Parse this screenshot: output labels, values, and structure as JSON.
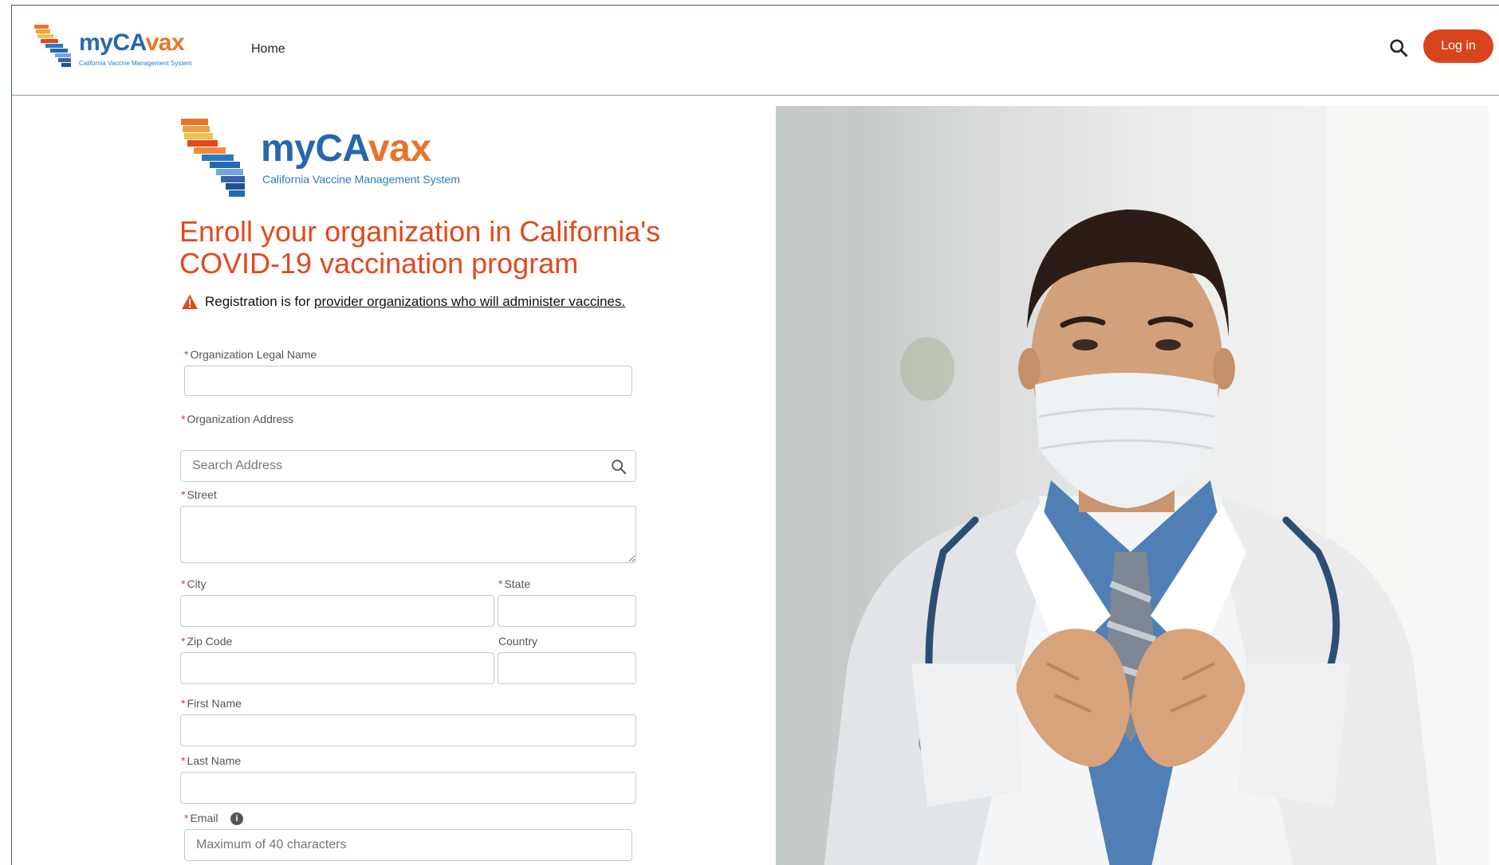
{
  "header": {
    "logo_word_part1": "myCA",
    "logo_word_part2": "vax",
    "logo_tagline": "California Vaccine Management System",
    "nav_home": "Home",
    "login_label": "Log in"
  },
  "brand": {
    "primary_orange": "#d9441c",
    "logo_blue": "#2567b0",
    "logo_orange": "#e8742a"
  },
  "main_logo": {
    "word_part1": "myCA",
    "word_part2": "vax",
    "tagline": "California Vaccine Management System"
  },
  "form": {
    "title_line1": "Enroll your organization in California's",
    "title_line2": "COVID-19 vaccination program",
    "notice_prefix": "Registration is for ",
    "notice_link": "provider organizations who will administer vaccines.",
    "fields": {
      "org_legal_name": {
        "label": "Organization Legal Name",
        "value": ""
      },
      "org_address": {
        "label": "Organization Address"
      },
      "search_address": {
        "placeholder": "Search Address"
      },
      "street": {
        "label": "Street",
        "value": ""
      },
      "city": {
        "label": "City",
        "value": ""
      },
      "state": {
        "label": "State",
        "value": ""
      },
      "zip": {
        "label": "Zip Code",
        "value": ""
      },
      "country": {
        "label": "Country",
        "value": ""
      },
      "first_name": {
        "label": "First Name",
        "value": ""
      },
      "last_name": {
        "label": "Last Name",
        "value": ""
      },
      "email": {
        "label": "Email",
        "placeholder": "Maximum of 40 characters"
      }
    },
    "required_marker": "*"
  },
  "icons": {
    "header_search": "search-icon",
    "login": "log-in",
    "address_search": "search-icon",
    "warning": "warning-triangle-icon",
    "email_info": "info-icon"
  }
}
